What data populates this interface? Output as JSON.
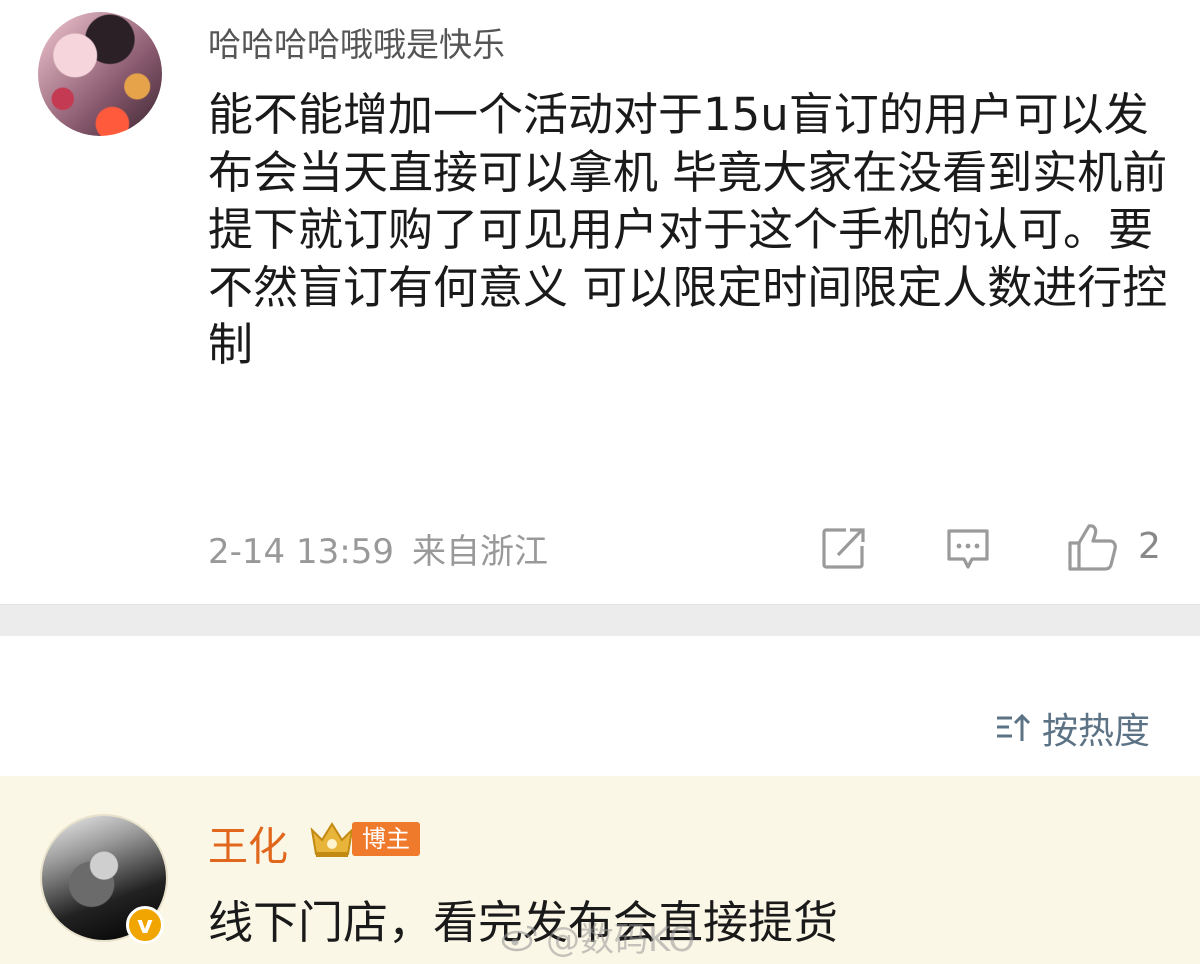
{
  "comment1": {
    "username": "哈哈哈哈哦哦是快乐",
    "text": "能不能增加一个活动对于15u盲订的用户可以发布会当天直接可以拿机 毕竟大家在没看到实机前提下就订购了可见用户对于这个手机的认可。要不然盲订有何意义 可以限定时间限定人数进行控制",
    "time": "2-14 13:59",
    "location": "来自浙江",
    "like_count": "2",
    "icons": {
      "share": "share-icon",
      "reply": "comment-icon",
      "like": "thumbs-up-icon"
    }
  },
  "sort": {
    "label": "按热度",
    "icon": "sort-icon"
  },
  "comment2": {
    "username": "王化",
    "badge": "博主",
    "vip_mark": "v",
    "text": "线下门店，看完发布会直接提货",
    "icons": {
      "crown": "crown-icon"
    }
  },
  "watermark": "@数码KO",
  "colors": {
    "username_highlight": "#e0671c",
    "badge_bg": "#f07a2c",
    "sort_text": "#5c7386",
    "highlight_bg": "#fbf7e6",
    "meta_text": "#999999"
  }
}
